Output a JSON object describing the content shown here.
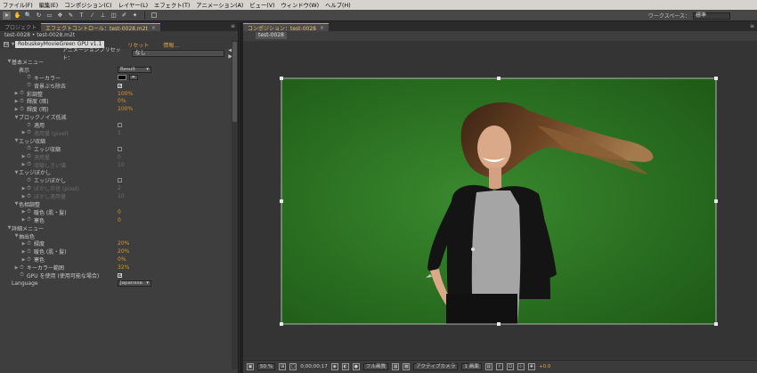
{
  "menu": [
    "ファイル(F)",
    "編集(E)",
    "コンポジション(C)",
    "レイヤー(L)",
    "エフェクト(T)",
    "アニメーション(A)",
    "ビュー(V)",
    "ウィンドウ(W)",
    "ヘルプ(H)"
  ],
  "toolbar": {
    "tools": [
      {
        "icon": "selection-arrow-icon",
        "glyph": "➤",
        "active": true
      },
      {
        "icon": "hand-icon",
        "glyph": "✋",
        "active": false
      },
      {
        "icon": "zoom-icon",
        "glyph": "🔍",
        "active": false
      },
      {
        "icon": "rotate-icon",
        "glyph": "↻",
        "active": false
      },
      {
        "icon": "camera-icon",
        "glyph": "▭",
        "active": false
      },
      {
        "icon": "pan-behind-icon",
        "glyph": "✥",
        "active": false
      },
      {
        "icon": "pen-icon",
        "glyph": "✎",
        "active": false
      },
      {
        "icon": "type-icon",
        "glyph": "T",
        "active": false
      },
      {
        "icon": "brush-icon",
        "glyph": "⁄",
        "active": false
      },
      {
        "icon": "clone-stamp-icon",
        "glyph": "⊥",
        "active": false
      },
      {
        "icon": "eraser-icon",
        "glyph": "◫",
        "active": false
      },
      {
        "icon": "roto-brush-icon",
        "glyph": "✐",
        "active": false
      },
      {
        "icon": "puppet-pin-icon",
        "glyph": "✦",
        "active": false
      }
    ],
    "workspace_label": "ワークスペース：",
    "workspace_value": "標準"
  },
  "left_panel": {
    "tabs": [
      {
        "label": "プロジェクト",
        "active": false
      },
      {
        "label": "エフェクトコントロール：test-0028.m2t",
        "active": true
      }
    ],
    "breadcrumb": "test-0028 • test-0028.m2t",
    "effect_name": "RobuskeyMovieGreen GPU v1.1",
    "reset_label": "リセット",
    "about_label": "情報...",
    "preset_label": "アニメーションプリセット：",
    "preset_value": "なし",
    "rows": [
      {
        "indent": 1,
        "twirl": "▼",
        "label": "基本メニュー"
      },
      {
        "indent": 2,
        "label": "表示",
        "dropdown": "Result"
      },
      {
        "indent": 3,
        "stopwatch": true,
        "label": "キーカラー",
        "swatch": "#050505"
      },
      {
        "indent": 3,
        "stopwatch": true,
        "label": "背景ぶち除去",
        "checkbox": "on"
      },
      {
        "indent": 2,
        "twirl": "▶",
        "stopwatch": true,
        "label": "彩調整",
        "value": "100%"
      },
      {
        "indent": 2,
        "twirl": "▶",
        "stopwatch": true,
        "label": "輝度 (暗)",
        "value": "0%"
      },
      {
        "indent": 2,
        "twirl": "▶",
        "stopwatch": true,
        "label": "輝度 (明)",
        "value": "100%"
      },
      {
        "indent": 2,
        "twirl": "▼",
        "label": "ブロックノイズ低減"
      },
      {
        "indent": 3,
        "stopwatch": true,
        "label": "適用",
        "checkbox": "off"
      },
      {
        "indent": 3,
        "twirl": "▶",
        "stopwatch": true,
        "label": "適用量 (pixel)",
        "value": "1",
        "dim": true
      },
      {
        "indent": 2,
        "twirl": "▼",
        "label": "エッジ収縮"
      },
      {
        "indent": 3,
        "stopwatch": true,
        "label": "エッジ収縮",
        "checkbox": "off"
      },
      {
        "indent": 3,
        "twirl": "▶",
        "stopwatch": true,
        "label": "適用量",
        "value": "0",
        "dim": true
      },
      {
        "indent": 3,
        "twirl": "▶",
        "stopwatch": true,
        "label": "収縮しきい値",
        "value": "10",
        "dim": true
      },
      {
        "indent": 2,
        "twirl": "▼",
        "label": "エッジぼかし"
      },
      {
        "indent": 3,
        "stopwatch": true,
        "label": "エッジぼかし",
        "checkbox": "off"
      },
      {
        "indent": 3,
        "twirl": "▶",
        "stopwatch": true,
        "label": "ぼかし半径 (pixel)",
        "value": "2",
        "dim": true
      },
      {
        "indent": 3,
        "twirl": "▶",
        "stopwatch": true,
        "label": "ぼかし適用量",
        "value": "10",
        "dim": true
      },
      {
        "indent": 2,
        "twirl": "▼",
        "label": "色相調整"
      },
      {
        "indent": 3,
        "twirl": "▶",
        "stopwatch": true,
        "label": "暖色 (肌・髪)",
        "value": "0"
      },
      {
        "indent": 3,
        "twirl": "▶",
        "stopwatch": true,
        "label": "寒色",
        "value": "0"
      },
      {
        "indent": 1,
        "twirl": "▼",
        "label": "詳細メニュー"
      },
      {
        "indent": 2,
        "twirl": "▼",
        "label": "抽出色"
      },
      {
        "indent": 3,
        "twirl": "▶",
        "stopwatch": true,
        "label": "緑度",
        "value": "20%"
      },
      {
        "indent": 3,
        "twirl": "▶",
        "stopwatch": true,
        "label": "暖色 (肌・髪)",
        "value": "20%"
      },
      {
        "indent": 3,
        "twirl": "▶",
        "stopwatch": true,
        "label": "寒色",
        "value": "0%"
      },
      {
        "indent": 2,
        "twirl": "▶",
        "stopwatch": true,
        "label": "キーカラー範囲",
        "value": "32%"
      },
      {
        "indent": 2,
        "stopwatch": true,
        "label": "GPU を使用 (使用可能な場合)",
        "checkbox": "on"
      },
      {
        "indent": 1,
        "label": "Language",
        "dropdown": "Japanese"
      }
    ]
  },
  "right_panel": {
    "tabs": [
      {
        "label": "コンポジション：test-0028",
        "active": true
      }
    ],
    "comp_subtab": "test-0028",
    "bottom_bar": {
      "zoom": "50 %",
      "timecode": "0;00;00;17",
      "resolution": "フル画質",
      "camera": "アクティブカメラ",
      "views": "1 画面",
      "exposure": "+0.0"
    }
  },
  "colors": {
    "accent": "#e39f2b",
    "value_orange": "#d8962e",
    "green_screen": "#2f7d26"
  }
}
